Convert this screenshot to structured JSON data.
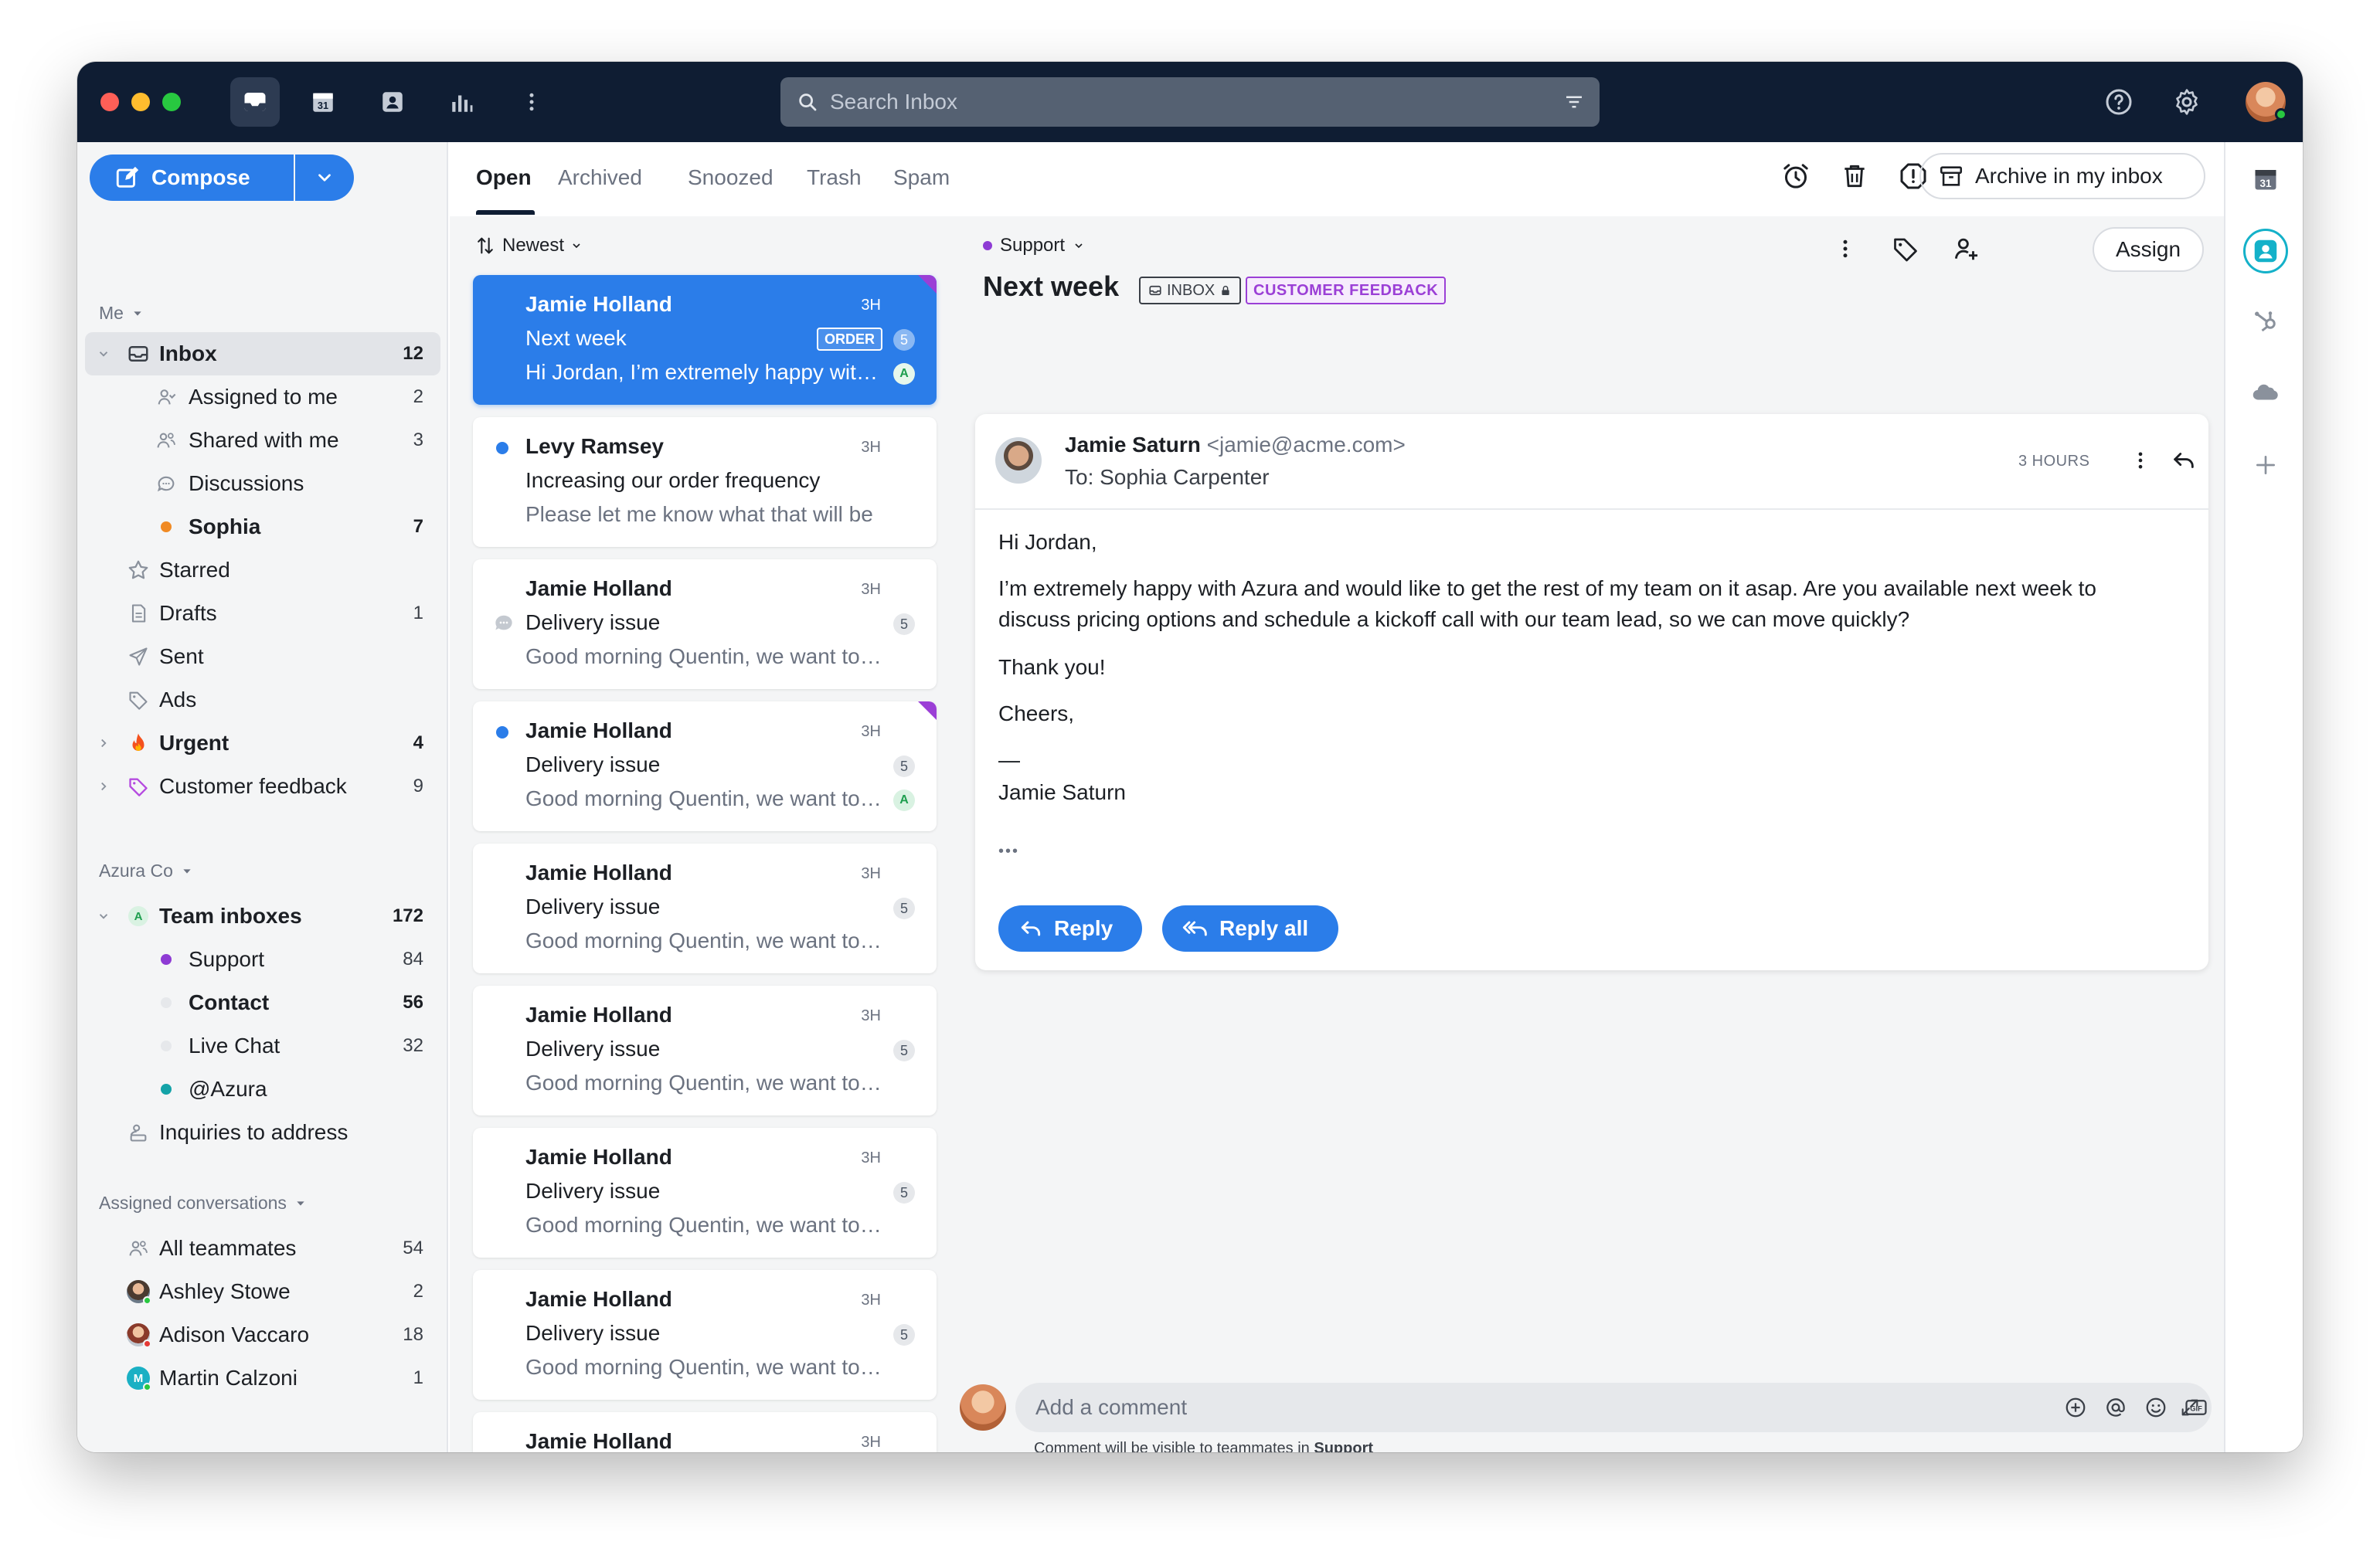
{
  "topbar": {
    "search_placeholder": "Search Inbox",
    "nav_icons": [
      "inbox-icon",
      "calendar-icon",
      "contacts-icon",
      "analytics-icon",
      "more-icon"
    ],
    "calendar_day": "31"
  },
  "sidebar": {
    "compose_label": "Compose",
    "me_header": "Me",
    "me_items": [
      {
        "label": "Inbox",
        "count": "12",
        "icon": "inbox-icon"
      },
      {
        "label": "Assigned to me",
        "count": "2",
        "icon": "assigned-icon"
      },
      {
        "label": "Shared with me",
        "count": "3",
        "icon": "shared-icon"
      },
      {
        "label": "Discussions",
        "count": "",
        "icon": "discussion-icon"
      },
      {
        "label": "Sophia",
        "count": "7",
        "icon": "orange-dot"
      },
      {
        "label": "Starred",
        "count": "",
        "icon": "star-icon"
      },
      {
        "label": "Drafts",
        "count": "1",
        "icon": "draft-icon"
      },
      {
        "label": "Sent",
        "count": "",
        "icon": "send-icon"
      },
      {
        "label": "Ads",
        "count": "",
        "icon": "tag-icon"
      },
      {
        "label": "Urgent",
        "count": "4",
        "icon": "fire-icon"
      },
      {
        "label": "Customer feedback",
        "count": "9",
        "icon": "tag-purple-icon"
      }
    ],
    "company_header": "Azura Co",
    "company_items": [
      {
        "label": "Team inboxes",
        "count": "172"
      },
      {
        "label": "Support",
        "count": "84",
        "color": "#8e3bd4"
      },
      {
        "label": "Contact",
        "count": "56",
        "color": "#e6e8eb"
      },
      {
        "label": "Live Chat",
        "count": "32",
        "color": "#e6e8eb"
      },
      {
        "label": "@Azura",
        "count": "",
        "color": "#14a3a8"
      },
      {
        "label": "Inquiries to address",
        "count": ""
      }
    ],
    "assigned_header": "Assigned conversations",
    "assigned_items": [
      {
        "label": "All teammates",
        "count": "54"
      },
      {
        "label": "Ashley Stowe",
        "count": "2"
      },
      {
        "label": "Adison Vaccaro",
        "count": "18"
      },
      {
        "label": "Martin Calzoni",
        "count": "1"
      }
    ]
  },
  "tabs": [
    "Open",
    "Archived",
    "Snoozed",
    "Trash",
    "Spam"
  ],
  "actions": {
    "archive_label": "Archive in my inbox",
    "assign_label": "Assign"
  },
  "list": {
    "sort_label": "Newest",
    "conversations": [
      {
        "from": "Jamie Holland",
        "time": "3H",
        "subject": "Next week",
        "preview": "Hi Jordan, I’m extremely happy with Azura",
        "tag": "ORDER",
        "count": "5",
        "avatar": "A"
      },
      {
        "from": "Levy Ramsey",
        "time": "3H",
        "subject": "Increasing our order frequency",
        "preview": "Please let me know what that will be",
        "count": "",
        "avatar": ""
      },
      {
        "from": "Jamie Holland",
        "time": "3H",
        "subject": "Delivery issue",
        "preview": "Good morning Quentin, we want to confirm",
        "count": "5",
        "avatar": ""
      },
      {
        "from": "Jamie Holland",
        "time": "3H",
        "subject": "Delivery issue",
        "preview": "Good morning Quentin, we want to confirm",
        "count": "5",
        "avatar": "A"
      },
      {
        "from": "Jamie Holland",
        "time": "3H",
        "subject": "Delivery issue",
        "preview": "Good morning Quentin, we want to confirm",
        "count": "5",
        "avatar": ""
      },
      {
        "from": "Jamie Holland",
        "time": "3H",
        "subject": "Delivery issue",
        "preview": "Good morning Quentin, we want to confirm",
        "count": "5",
        "avatar": ""
      },
      {
        "from": "Jamie Holland",
        "time": "3H",
        "subject": "Delivery issue",
        "preview": "Good morning Quentin, we want to confirm",
        "count": "5",
        "avatar": ""
      },
      {
        "from": "Jamie Holland",
        "time": "3H",
        "subject": "Delivery issue",
        "preview": "Good morning Quentin, we want to confirm",
        "count": "5",
        "avatar": ""
      },
      {
        "from": "Jamie Holland",
        "time": "3H",
        "subject": "",
        "preview": "",
        "count": "",
        "avatar": ""
      }
    ]
  },
  "detail": {
    "inbox_tag": "Support",
    "subject": "Next week",
    "inbox_pill": "INBOX",
    "feedback_pill": "CUSTOMER FEEDBACK",
    "sender_name": "Jamie Saturn",
    "sender_email": "<jamie@acme.com>",
    "to": "To: Sophia Carpenter",
    "time": "3 HOURS",
    "body": {
      "greeting": "Hi Jordan,",
      "paragraph": "I’m extremely happy with Azura and would like to get the rest of my team on it asap. Are you available next week to discuss pricing options and schedule a kickoff call with our team lead, so we can move quickly?",
      "thanks": "Thank you!",
      "closing": "Cheers,",
      "dash": "—",
      "signature": "Jamie Saturn",
      "ellipsis": "•••"
    },
    "reply_label": "Reply",
    "reply_all_label": "Reply all"
  },
  "comment": {
    "placeholder": "Add a comment",
    "note_prefix": "Comment will be visible to teammates in",
    "note_team": "Support"
  }
}
